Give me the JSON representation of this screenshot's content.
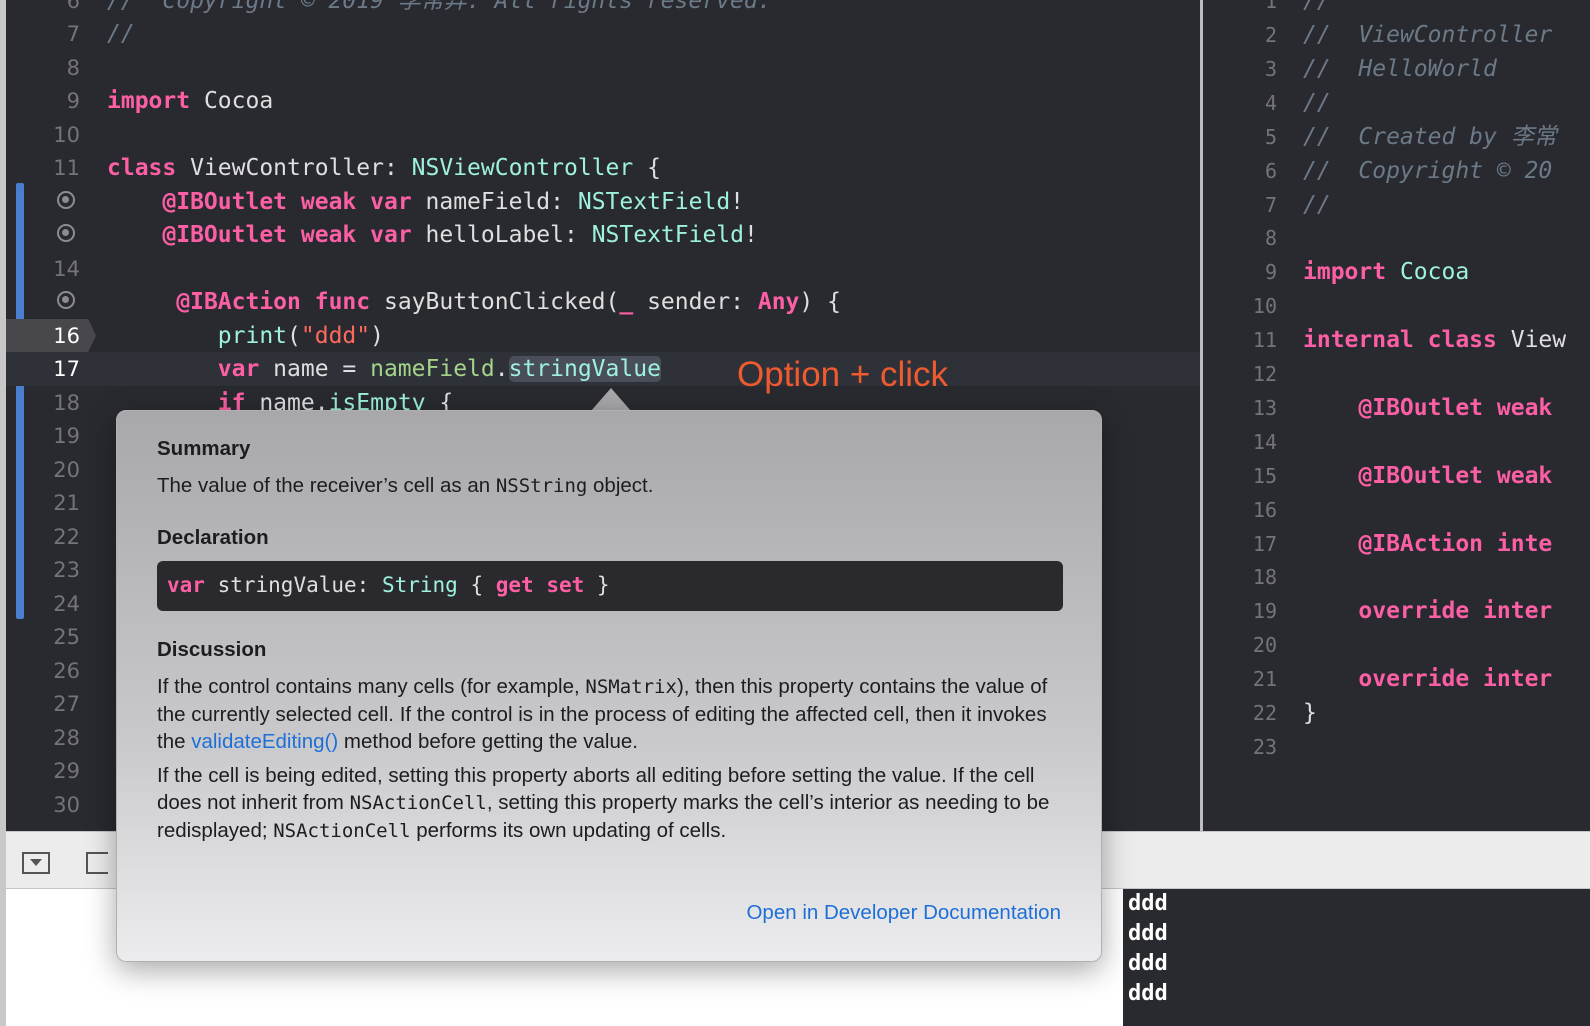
{
  "editor_left": {
    "current_line": 17,
    "debug_line": 16,
    "breakpoint_lines": [
      12,
      13,
      15
    ],
    "lines": [
      {
        "n": 6,
        "tokens": [
          [
            "//  Copyright © 2019 李常异. All rights reserved.",
            "c"
          ]
        ]
      },
      {
        "n": 7,
        "tokens": [
          [
            "//",
            "c"
          ]
        ]
      },
      {
        "n": 8,
        "tokens": []
      },
      {
        "n": 9,
        "tokens": [
          [
            "import",
            "k"
          ],
          [
            " Cocoa",
            "p"
          ]
        ]
      },
      {
        "n": 10,
        "tokens": []
      },
      {
        "n": 11,
        "tokens": [
          [
            "class",
            "k"
          ],
          [
            " ViewController: ",
            "p"
          ],
          [
            "NSViewController",
            "t"
          ],
          [
            " {",
            "p"
          ]
        ]
      },
      {
        "n": 12,
        "tokens": [
          [
            "    ",
            "p"
          ],
          [
            "@IBOutlet",
            "k"
          ],
          [
            " ",
            "p"
          ],
          [
            "weak",
            "k"
          ],
          [
            " ",
            "p"
          ],
          [
            "var",
            "k"
          ],
          [
            " nameField: ",
            "p"
          ],
          [
            "NSTextField",
            "t"
          ],
          [
            "!",
            "p"
          ]
        ]
      },
      {
        "n": 13,
        "tokens": [
          [
            "    ",
            "p"
          ],
          [
            "@IBOutlet",
            "k"
          ],
          [
            " ",
            "p"
          ],
          [
            "weak",
            "k"
          ],
          [
            " ",
            "p"
          ],
          [
            "var",
            "k"
          ],
          [
            " helloLabel: ",
            "p"
          ],
          [
            "NSTextField",
            "t"
          ],
          [
            "!",
            "p"
          ]
        ]
      },
      {
        "n": 14,
        "tokens": []
      },
      {
        "n": 15,
        "tokens": [
          [
            "     ",
            "p"
          ],
          [
            "@IBAction",
            "k"
          ],
          [
            " ",
            "p"
          ],
          [
            "func",
            "k"
          ],
          [
            " sayButtonClicked(",
            "p"
          ],
          [
            "_",
            "k"
          ],
          [
            " sender: ",
            "p"
          ],
          [
            "Any",
            "k"
          ],
          [
            ") {",
            "p"
          ]
        ]
      },
      {
        "n": 16,
        "tokens": [
          [
            "        ",
            "p"
          ],
          [
            "print",
            "t"
          ],
          [
            "(",
            "p"
          ],
          [
            "\"ddd\"",
            "s"
          ],
          [
            ")",
            "p"
          ]
        ]
      },
      {
        "n": 17,
        "tokens": [
          [
            "        ",
            "p"
          ],
          [
            "var",
            "k"
          ],
          [
            " name = ",
            "p"
          ],
          [
            "nameField",
            "f"
          ],
          [
            ".",
            "p"
          ],
          [
            "stringValue",
            "hl"
          ]
        ]
      },
      {
        "n": 18,
        "tokens": [
          [
            "        ",
            "p"
          ],
          [
            "if",
            "k"
          ],
          [
            " name.",
            "p"
          ],
          [
            "isEmpty",
            "t"
          ],
          [
            " {",
            "p"
          ]
        ]
      },
      {
        "n": 19,
        "tokens": []
      },
      {
        "n": 20,
        "tokens": []
      },
      {
        "n": 21,
        "tokens": []
      },
      {
        "n": 22,
        "tokens": []
      },
      {
        "n": 23,
        "tokens": []
      },
      {
        "n": 24,
        "tokens": []
      },
      {
        "n": 25,
        "tokens": []
      },
      {
        "n": 26,
        "tokens": []
      },
      {
        "n": 27,
        "tokens": []
      },
      {
        "n": 28,
        "tokens": []
      },
      {
        "n": 29,
        "tokens": []
      },
      {
        "n": 30,
        "tokens": []
      }
    ]
  },
  "editor_right": {
    "lines": [
      {
        "n": 1,
        "tokens": [
          [
            "//",
            "c"
          ]
        ]
      },
      {
        "n": 2,
        "tokens": [
          [
            "//  ViewController",
            "c"
          ]
        ]
      },
      {
        "n": 3,
        "tokens": [
          [
            "//  HelloWorld",
            "c"
          ]
        ]
      },
      {
        "n": 4,
        "tokens": [
          [
            "//",
            "c"
          ]
        ]
      },
      {
        "n": 5,
        "tokens": [
          [
            "//  Created by 李常",
            "c"
          ]
        ]
      },
      {
        "n": 6,
        "tokens": [
          [
            "//  Copyright © 20",
            "c"
          ]
        ]
      },
      {
        "n": 7,
        "tokens": [
          [
            "//",
            "c"
          ]
        ]
      },
      {
        "n": 8,
        "tokens": []
      },
      {
        "n": 9,
        "tokens": [
          [
            "import",
            "k"
          ],
          [
            " ",
            "p"
          ],
          [
            "Cocoa",
            "t"
          ]
        ]
      },
      {
        "n": 10,
        "tokens": []
      },
      {
        "n": 11,
        "tokens": [
          [
            "internal",
            "k"
          ],
          [
            " ",
            "p"
          ],
          [
            "class",
            "k"
          ],
          [
            " View",
            "p"
          ]
        ]
      },
      {
        "n": 12,
        "tokens": []
      },
      {
        "n": 13,
        "tokens": [
          [
            "    ",
            "p"
          ],
          [
            "@IBOutlet",
            "k"
          ],
          [
            " ",
            "p"
          ],
          [
            "weak",
            "k"
          ]
        ]
      },
      {
        "n": 14,
        "tokens": []
      },
      {
        "n": 15,
        "tokens": [
          [
            "    ",
            "p"
          ],
          [
            "@IBOutlet",
            "k"
          ],
          [
            " ",
            "p"
          ],
          [
            "weak",
            "k"
          ]
        ]
      },
      {
        "n": 16,
        "tokens": []
      },
      {
        "n": 17,
        "tokens": [
          [
            "    ",
            "p"
          ],
          [
            "@IBAction",
            "k"
          ],
          [
            " ",
            "p"
          ],
          [
            "inte",
            "k"
          ]
        ]
      },
      {
        "n": 18,
        "tokens": []
      },
      {
        "n": 19,
        "tokens": [
          [
            "    ",
            "p"
          ],
          [
            "override",
            "k"
          ],
          [
            " ",
            "p"
          ],
          [
            "inter",
            "k"
          ]
        ]
      },
      {
        "n": 20,
        "tokens": []
      },
      {
        "n": 21,
        "tokens": [
          [
            "    ",
            "p"
          ],
          [
            "override",
            "k"
          ],
          [
            " ",
            "p"
          ],
          [
            "inter",
            "k"
          ]
        ]
      },
      {
        "n": 22,
        "tokens": [
          [
            "}",
            "p"
          ]
        ]
      },
      {
        "n": 23,
        "tokens": []
      }
    ]
  },
  "annotation": "Option + click",
  "quick_help": {
    "summary_heading": "Summary",
    "summary_pre": "The value of the receiver’s cell as an ",
    "summary_code": "NSString",
    "summary_post": " object.",
    "declaration_heading": "Declaration",
    "declaration_tokens": [
      [
        "var",
        "k"
      ],
      [
        " stringValue: ",
        "p"
      ],
      [
        "String",
        "t"
      ],
      [
        " { ",
        "p"
      ],
      [
        "get",
        "k"
      ],
      [
        " ",
        "p"
      ],
      [
        "set",
        "k"
      ],
      [
        " }",
        "p"
      ]
    ],
    "discussion_heading": "Discussion",
    "para1_a": "If the control contains many cells (for example, ",
    "para1_code": "NSMatrix",
    "para1_b": "), then this property contains the value of the currently selected cell. If the control is in the process of editing the affected cell, then it invokes the ",
    "para1_link": "validateEditing()",
    "para1_c": " method before getting the value.",
    "para2_a": "If the cell is being edited, setting this property aborts all editing before setting the value. If the cell does not inherit from ",
    "para2_code1": "NSActionCell",
    "para2_b": ", setting this property marks the cell’s interior as needing to be redisplayed; ",
    "para2_code2": "NSActionCell",
    "para2_c": " performs its own updating of cells.",
    "open_docs_link": "Open in Developer Documentation"
  },
  "console": {
    "output": [
      "ddd",
      "ddd",
      "ddd",
      "ddd"
    ]
  },
  "icons": {
    "hide_debug": "triangle-down-in-box-icon",
    "breakpoint_toggle": "breakpoint-tag-icon"
  },
  "colors": {
    "keyword": "#fc5fa3",
    "type": "#9ef1dd",
    "string": "#fc6a5d",
    "comment": "#6c7986",
    "link": "#1d6fd8",
    "annotation": "#ef5a2f",
    "change_bar": "#4a7fd0"
  }
}
